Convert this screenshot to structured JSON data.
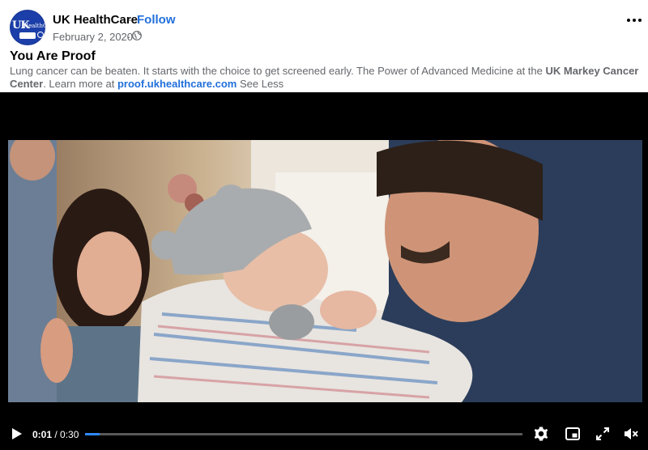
{
  "header": {
    "page_name": "UK HealthCare",
    "separator": "·",
    "follow_label": "Follow",
    "date": "February 2, 2020",
    "date_separator": "·",
    "avatar_icon": "uk-healthcare-logo",
    "privacy_icon": "globe-icon",
    "more_icon": "more-options-icon"
  },
  "post": {
    "title": "You Are Proof",
    "text_part1": "Lung cancer can be beaten. It starts with the choice to get screened early. The Power of Advanced Medicine at the ",
    "text_bold": "UK Markey Cancer Center",
    "text_part2": ". Learn more at ",
    "link": "proof.ukhealthcare.com",
    "see_less": "See Less"
  },
  "video": {
    "current_time": "0:01",
    "time_separator": " / ",
    "total_time": "0:30",
    "progress_fraction": 0.033,
    "icons": {
      "play": "play-icon",
      "settings": "settings-gear-icon",
      "pip": "picture-in-picture-icon",
      "fullscreen": "fullscreen-icon",
      "mute": "muted-speaker-icon"
    }
  },
  "colors": {
    "link_blue": "#216fdb",
    "avatar_blue": "#1b3ea8",
    "progress_blue": "#2d88ff"
  }
}
